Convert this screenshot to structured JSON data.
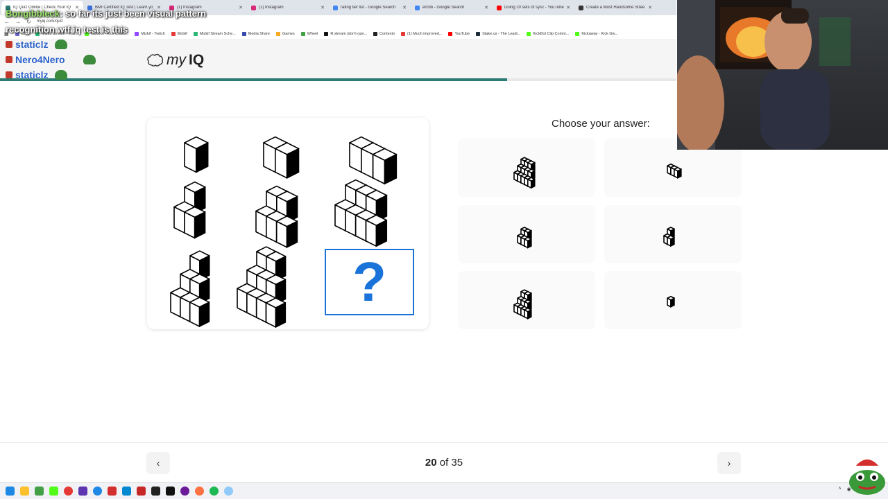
{
  "browser": {
    "tabs": [
      {
        "label": "IQ Quiz Online | Check Your IQ",
        "color": "#2b7a73",
        "active": true
      },
      {
        "label": "BMI Certified IQ Test | Learn yo",
        "color": "#3a6fd8"
      },
      {
        "label": "(1) Instagram",
        "color": "#d62976"
      },
      {
        "label": "(1) Instagram",
        "color": "#d62976"
      },
      {
        "label": "rating tier list - Google Search",
        "color": "#4285f4"
      },
      {
        "label": "ercbb - Google Search",
        "color": "#4285f4"
      },
      {
        "label": "Doing 20 sets of sysc - YouTube",
        "color": "#ff0000"
      },
      {
        "label": "Create a Most Handsome Stree",
        "color": "#333333"
      }
    ],
    "url": "myiq.com/quiz",
    "bookmarks": [
      {
        "label": "Capt",
        "color": "#6b6bd6"
      },
      {
        "label": "Mizkif Stream - Wat...",
        "color": "#2bb673"
      },
      {
        "label": "KickBot - Kick Chatb...",
        "color": "#53fc18"
      },
      {
        "label": "Mizkif - Twitch",
        "color": "#9146ff"
      },
      {
        "label": "Mizkif",
        "color": "#e53935"
      },
      {
        "label": "Mizkif Stream Sche...",
        "color": "#2bb673"
      },
      {
        "label": "Media Share",
        "color": "#3949ab"
      },
      {
        "label": "Games",
        "color": "#f9a825"
      },
      {
        "label": "Wheel",
        "color": "#43a047"
      },
      {
        "label": "R.stream (don't ope...",
        "color": "#111111"
      },
      {
        "label": "Contexto",
        "color": "#222222"
      },
      {
        "label": "(1) Much improved...",
        "color": "#e53935"
      },
      {
        "label": "YouTube",
        "color": "#ff0000"
      },
      {
        "label": "Stake.us - The Leadi...",
        "color": "#1a2c38"
      },
      {
        "label": "KickBot Clip Comm...",
        "color": "#53fc18"
      },
      {
        "label": "Kickaway - Kick Giv...",
        "color": "#53fc18"
      }
    ]
  },
  "chat": {
    "message_user": "Bongibbleck",
    "message_text": ": so far its just been visual pattern",
    "message_text_2": "recognition wtf iq test is this",
    "names": [
      "staticlz",
      "Nero4Nero",
      "staticlz"
    ],
    "name_color": "#2c62c9"
  },
  "site": {
    "logo_my": "my",
    "logo_iq": "IQ",
    "progress_fraction": 0.75,
    "accent": "#2b7a73"
  },
  "quiz": {
    "prompt": "Choose your answer:",
    "question_mark": "?",
    "current": "20",
    "of_text": "of",
    "total": "35",
    "question_mark_color": "#1a73d9"
  }
}
